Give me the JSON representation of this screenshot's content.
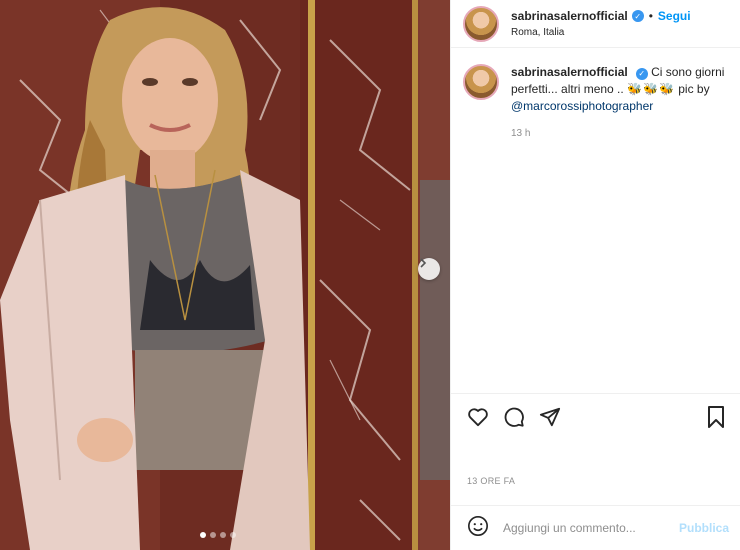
{
  "header": {
    "username": "sabrinasalernofficial",
    "separator": "•",
    "follow_label": "Segui",
    "location": "Roma, Italia"
  },
  "caption": {
    "username": "sabrinasalernofficial",
    "text": "Ci sono giorni perfetti... altri meno ..",
    "emoji": "🐝🐝🐝",
    "credit": "pic by",
    "mention": "@marcorossiphotographer",
    "time": "13 h"
  },
  "post": {
    "time_label": "13 ORE FA"
  },
  "comment": {
    "placeholder": "Aggiungi un commento...",
    "publish_label": "Pubblica"
  },
  "carousel": {
    "slide_count": 4,
    "active_slide": 1
  },
  "icons": {
    "like": "heart-icon",
    "comment": "comment-icon",
    "share": "send-icon",
    "save": "bookmark-icon",
    "emoji": "emoji-icon",
    "next": "chevron-right-icon",
    "verified": "verified-badge-icon"
  },
  "colors": {
    "accent": "#0095f6",
    "verified": "#3897f0",
    "publish_disabled": "#b2dffc",
    "muted": "#8e8e8e"
  }
}
